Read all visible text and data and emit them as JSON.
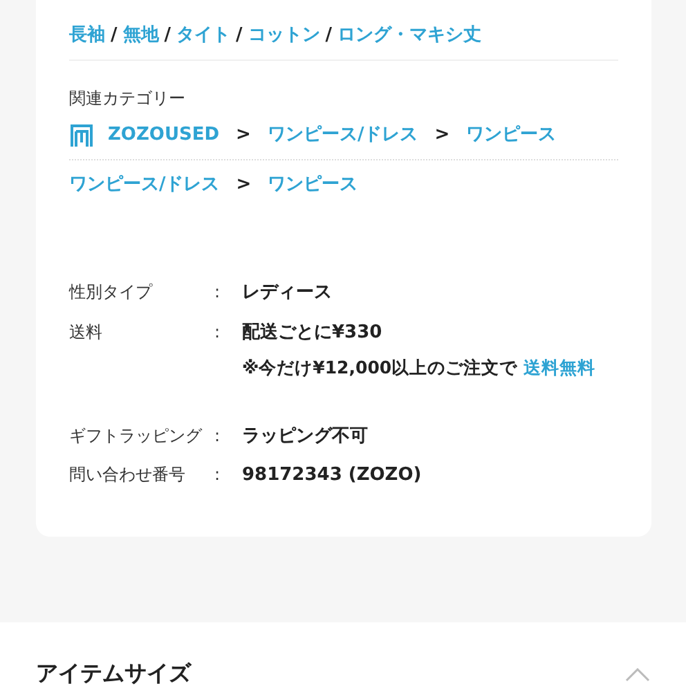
{
  "tags": {
    "items": [
      "長袖",
      "無地",
      "タイト",
      "コットン",
      "ロング・マキシ丈"
    ],
    "separator": "/"
  },
  "related_categories": {
    "title": "関連カテゴリー",
    "separator": ">",
    "paths": [
      [
        {
          "text": "ZOZOUSED",
          "kind": "shop"
        },
        {
          "text": "ワンピース/ドレス",
          "kind": "link"
        },
        {
          "text": "ワンピース",
          "kind": "link"
        }
      ],
      [
        {
          "text": "ワンピース/ドレス",
          "kind": "link"
        },
        {
          "text": "ワンピース",
          "kind": "link"
        }
      ]
    ]
  },
  "details": {
    "colon": ":",
    "groups": [
      [
        {
          "label": "性別タイプ",
          "value": "レディース"
        },
        {
          "label": "送料",
          "value": "配送ごとに¥330",
          "note": {
            "text": "※今だけ¥12,000以上のご注文で",
            "link": "送料無料"
          }
        }
      ],
      [
        {
          "label": "ギフトラッピング",
          "value": "ラッピング不可"
        },
        {
          "label": "問い合わせ番号",
          "value": "98172343 (ZOZO)"
        }
      ]
    ]
  },
  "section": {
    "title": "アイテムサイズ",
    "expanded": true
  }
}
